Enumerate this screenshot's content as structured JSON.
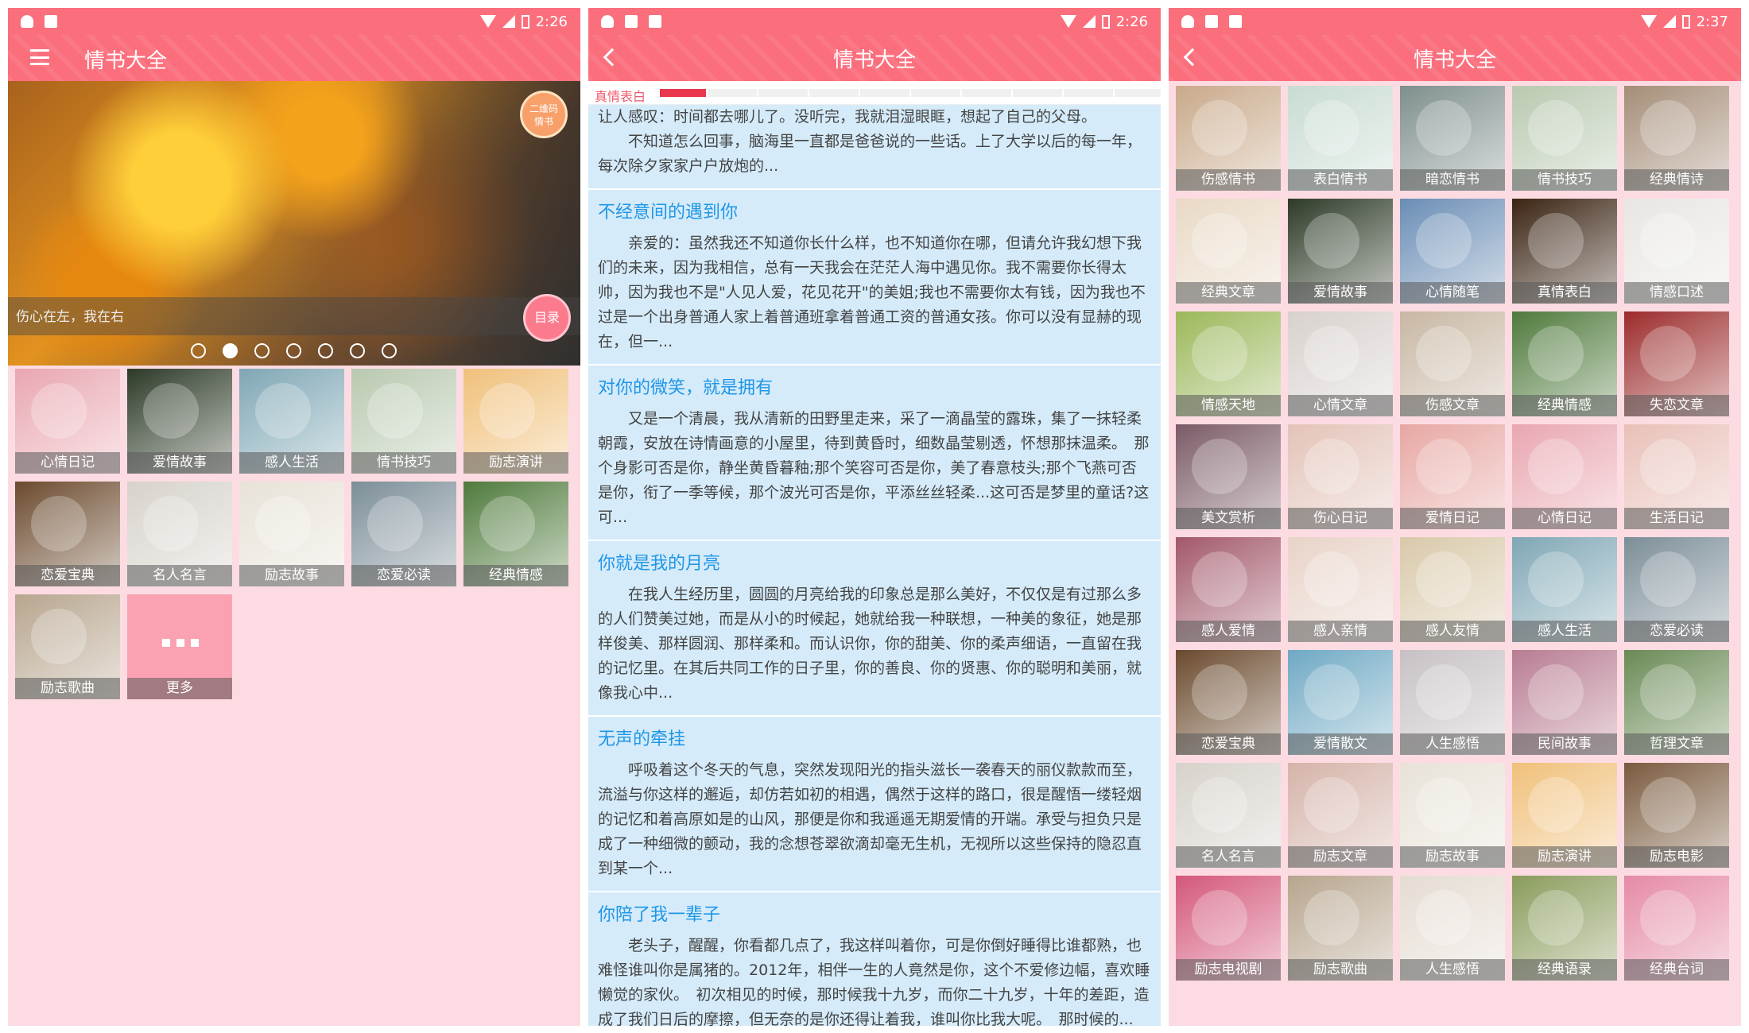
{
  "phone1": {
    "status_time": "2:26",
    "title": "情书大全",
    "banner": {
      "badge": "二维码\n情书",
      "caption": "伤心在左，我在右",
      "mulu": "目录",
      "dot_count": 7,
      "active_dot": 2
    },
    "tiles": [
      {
        "label": "心情日记",
        "color": "#e9a6b0"
      },
      {
        "label": "爱情故事",
        "color": "#2d3a27"
      },
      {
        "label": "感人生活",
        "color": "#7fa7b5"
      },
      {
        "label": "情书技巧",
        "color": "#b9c9b0"
      },
      {
        "label": "励志演讲",
        "color": "#f0c07a"
      },
      {
        "label": "恋爱宝典",
        "color": "#6b4a2e"
      },
      {
        "label": "名人名言",
        "color": "#d7d2cb"
      },
      {
        "label": "励志故事",
        "color": "#e8e2d7"
      },
      {
        "label": "恋爱必读",
        "color": "#7c8e98"
      },
      {
        "label": "经典情感",
        "color": "#4f7a3c"
      },
      {
        "label": "励志歌曲",
        "color": "#b7a58e"
      }
    ],
    "more_label": "更多"
  },
  "phone2": {
    "status_time": "2:26",
    "title": "情书大全",
    "tab_label": "真情表白",
    "cards": [
      {
        "title": "",
        "body": "让人感叹：时间都去哪儿了。没听完，我就泪湿眼眶，想起了自己的父母。\n　　不知道怎么回事，脑海里一直都是爸爸说的一些话。上了大学以后的每一年，每次除夕家家户户放炮的..."
      },
      {
        "title": "不经意间的遇到你",
        "body": "亲爱的：虽然我还不知道你长什么样，也不知道你在哪，但请允许我幻想下我们的未来，因为我相信，总有一天我会在茫茫人海中遇见你。我不需要你长得太帅，因为我也不是\"人见人爱，花见花开\"的美姐;我也不需要你太有钱，因为我也不过是一个出身普通人家上着普通班拿着普通工资的普通女孩。你可以没有显赫的现在，但一..."
      },
      {
        "title": "对你的微笑，就是拥有",
        "body": "又是一个清晨，我从清新的田野里走来，采了一滴晶莹的露珠，集了一抹轻柔朝霞，安放在诗情画意的小屋里，待到黄昏时，细数晶莹剔透，怀想那抹温柔。　那个身影可否是你，静坐黄昏暮釉;那个笑容可否是你，美了春意枝头;那个飞燕可否是你，衔了一季等候，那个波光可否是你，平添丝丝轻柔...这可否是梦里的童话?这可..."
      },
      {
        "title": "你就是我的月亮",
        "body": "在我人生经历里，圆圆的月亮给我的印象总是那么美好，不仅仅是有过那么多的人们赞美过她，而是从小的时候起，她就给我一种联想，一种美的象征，她是那样俊美、那样圆润、那样柔和。而认识你，你的甜美、你的柔声细语，一直留在我的记忆里。在其后共同工作的日子里，你的善良、你的贤惠、你的聪明和美丽，就像我心中..."
      },
      {
        "title": "无声的牵挂",
        "body": "呼吸着这个冬天的气息，突然发现阳光的指头滋长一袭春天的丽仪款款而至，流溢与你这样的邂逅，却仿若如初的相遇，偶然于这样的路口，很是醒悟一缕轻烟的记忆和着高原如是的山风，那便是你和我遥遥无期爱情的开端。承受与担负只是成了一种细微的颤动，我的念想苍翠欲滴却毫无生机，无视所以这些保持的隐忍直到某一个..."
      },
      {
        "title": "你陪了我一辈子",
        "body": "老头子，醒醒，你看都几点了，我这样叫着你，可是你倒好睡得比谁都熟，也难怪谁叫你是属猪的。2012年，相伴一生的人竟然是你，这个不爱修边幅，喜欢睡懒觉的家伙。　初次相见的时候，那时候我十九岁，而你二十九岁，十年的差距，造成了我们日后的摩擦，但无奈的是你还得让着我，谁叫你比我大呢。　那时候的..."
      }
    ]
  },
  "phone3": {
    "status_time": "2:37",
    "title": "情书大全",
    "tiles": [
      {
        "label": "伤感情书",
        "color": "#c9a98a"
      },
      {
        "label": "表白情书",
        "color": "#c8dcd2"
      },
      {
        "label": "暗恋情书",
        "color": "#7e8f8c"
      },
      {
        "label": "情书技巧",
        "color": "#b9c9b0"
      },
      {
        "label": "经典情诗",
        "color": "#a58d78"
      },
      {
        "label": "经典文章",
        "color": "#e9d9c5"
      },
      {
        "label": "爱情故事",
        "color": "#2d3a27"
      },
      {
        "label": "心情随笔",
        "color": "#6a8db5"
      },
      {
        "label": "真情表白",
        "color": "#3a2312"
      },
      {
        "label": "情感口述",
        "color": "#e8e6e2"
      },
      {
        "label": "情感天地",
        "color": "#9bb85a"
      },
      {
        "label": "心情文章",
        "color": "#d8d1cd"
      },
      {
        "label": "伤感文章",
        "color": "#c8b7a3"
      },
      {
        "label": "经典情感",
        "color": "#4f7a3c"
      },
      {
        "label": "失恋文章",
        "color": "#9c2b2b"
      },
      {
        "label": "美文赏析",
        "color": "#7a5a66"
      },
      {
        "label": "伤心日记",
        "color": "#e3c3b8"
      },
      {
        "label": "爱情日记",
        "color": "#e7a7a3"
      },
      {
        "label": "心情日记",
        "color": "#e9a6b0"
      },
      {
        "label": "生活日记",
        "color": "#e9c0b8"
      },
      {
        "label": "感人爱情",
        "color": "#a2586a"
      },
      {
        "label": "感人亲情",
        "color": "#e8d3c8"
      },
      {
        "label": "感人友情",
        "color": "#d9c9aa"
      },
      {
        "label": "感人生活",
        "color": "#7fa7b5"
      },
      {
        "label": "恋爱必读",
        "color": "#7c8e98"
      },
      {
        "label": "恋爱宝典",
        "color": "#6b4a2e"
      },
      {
        "label": "爱情散文",
        "color": "#6fa9c4"
      },
      {
        "label": "人生感悟",
        "color": "#c7c1c3"
      },
      {
        "label": "民间故事",
        "color": "#b87c92"
      },
      {
        "label": "哲理文章",
        "color": "#6a8a55"
      },
      {
        "label": "名人名言",
        "color": "#d7d2cb"
      },
      {
        "label": "励志文章",
        "color": "#d5b3a9"
      },
      {
        "label": "励志故事",
        "color": "#e8e2d7"
      },
      {
        "label": "励志演讲",
        "color": "#f0c07a"
      },
      {
        "label": "励志电影",
        "color": "#7a5a3e"
      },
      {
        "label": "励志电视剧",
        "color": "#d4577a"
      },
      {
        "label": "励志歌曲",
        "color": "#b7a58e"
      },
      {
        "label": "人生感悟",
        "color": "#e5dcd2"
      },
      {
        "label": "经典语录",
        "color": "#8a9c5c"
      },
      {
        "label": "经典台词",
        "color": "#e58aa6"
      }
    ]
  }
}
